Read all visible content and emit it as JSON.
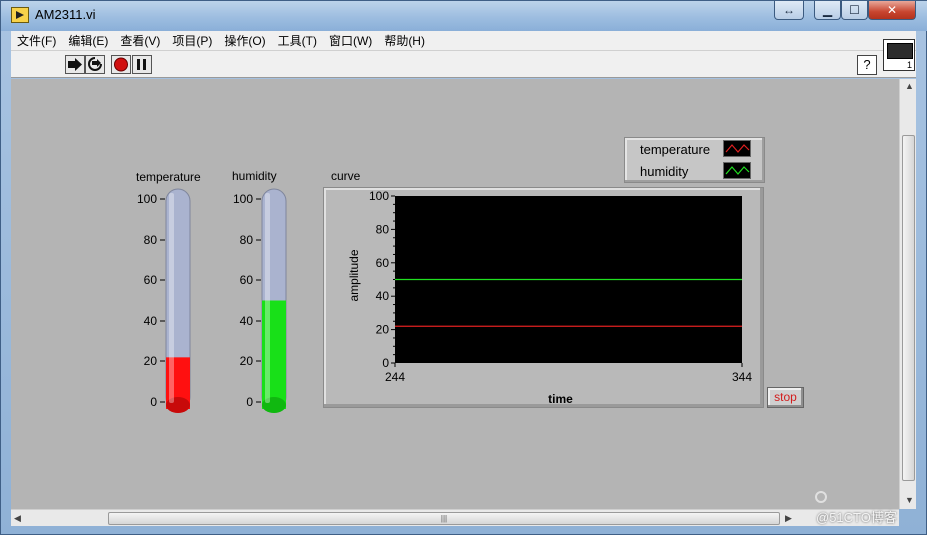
{
  "window": {
    "title": "AM2311.vi"
  },
  "menu": [
    "文件(F)",
    "编辑(E)",
    "查看(V)",
    "项目(P)",
    "操作(O)",
    "工具(T)",
    "窗口(W)",
    "帮助(H)"
  ],
  "toolbar": {
    "icons": [
      "run-arrow",
      "run-continuously",
      "abort-execution",
      "pause"
    ],
    "help": "?",
    "vi_icon_number": "1"
  },
  "thermometers": [
    {
      "label": "temperature",
      "value": 22,
      "fill_color": "#ff1010",
      "ticks": [
        "100",
        "80",
        "60",
        "40",
        "20",
        "0"
      ]
    },
    {
      "label": "humidity",
      "value": 50,
      "fill_color": "#18e018",
      "ticks": [
        "100",
        "80",
        "60",
        "40",
        "20",
        "0"
      ]
    }
  ],
  "graph": {
    "label": "curve",
    "legend": [
      {
        "name": "temperature",
        "color": "#e02020"
      },
      {
        "name": "humidity",
        "color": "#20e020"
      }
    ],
    "stop_label": "stop"
  },
  "chart_data": {
    "type": "line",
    "xlabel": "time",
    "ylabel": "amplitude",
    "xlim": [
      244,
      344
    ],
    "ylim": [
      0,
      100
    ],
    "x_ticks": [
      "244",
      "344"
    ],
    "y_ticks": [
      "100",
      "80",
      "60",
      "40",
      "20",
      "0"
    ],
    "series": [
      {
        "name": "temperature",
        "color": "#e02020",
        "x": [
          244,
          344
        ],
        "y": [
          22,
          22
        ]
      },
      {
        "name": "humidity",
        "color": "#20e020",
        "x": [
          244,
          344
        ],
        "y": [
          50,
          50
        ]
      }
    ]
  },
  "watermark": "@51CTO博客"
}
